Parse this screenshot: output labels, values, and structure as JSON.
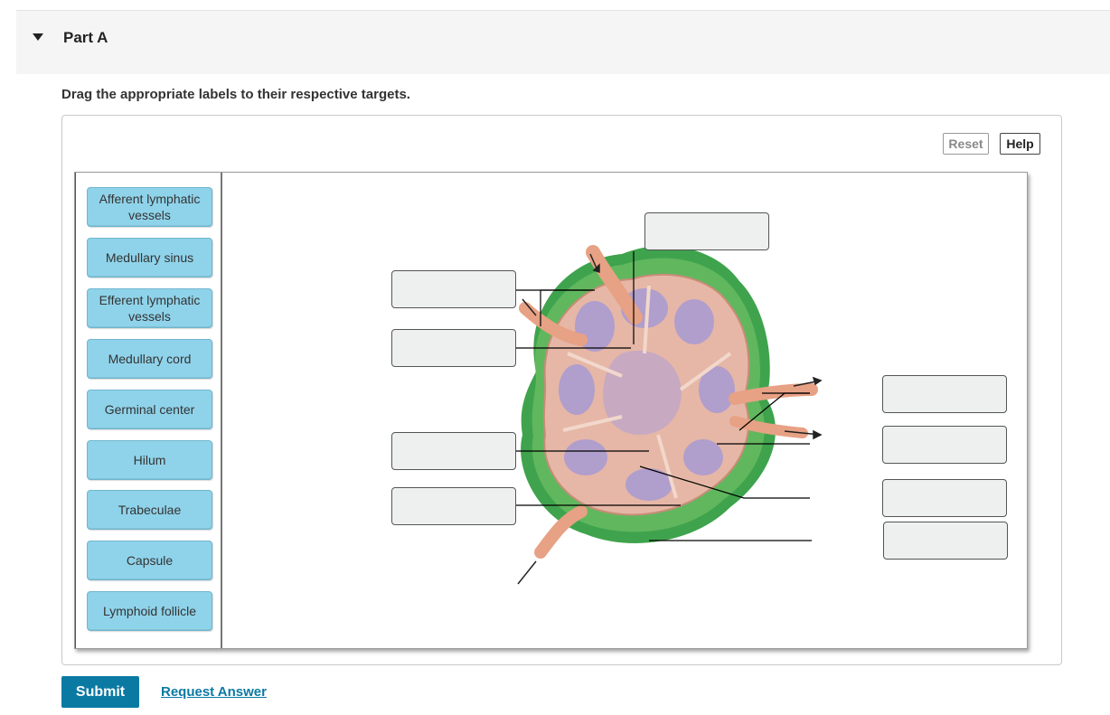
{
  "part": {
    "title": "Part A"
  },
  "instructions": "Drag the appropriate labels to their respective targets.",
  "toolbar": {
    "reset_label": "Reset",
    "help_label": "Help"
  },
  "labels": [
    "Afferent lymphatic vessels",
    "Medullary sinus",
    "Efferent lymphatic vessels",
    "Medullary cord",
    "Germinal center",
    "Hilum",
    "Trabeculae",
    "Capsule",
    "Lymphoid follicle"
  ],
  "colors": {
    "label_fill": "#8fd3ea",
    "target_fill": "#eef0f0",
    "capsule_green": "#3fa34d",
    "tissue_pink": "#e6b7a6",
    "follicle_purple": "#a79ad3",
    "vessel": "#e7a184",
    "submit": "#0b7aa3"
  },
  "actions": {
    "submit_label": "Submit",
    "request_answer_label": "Request Answer"
  }
}
